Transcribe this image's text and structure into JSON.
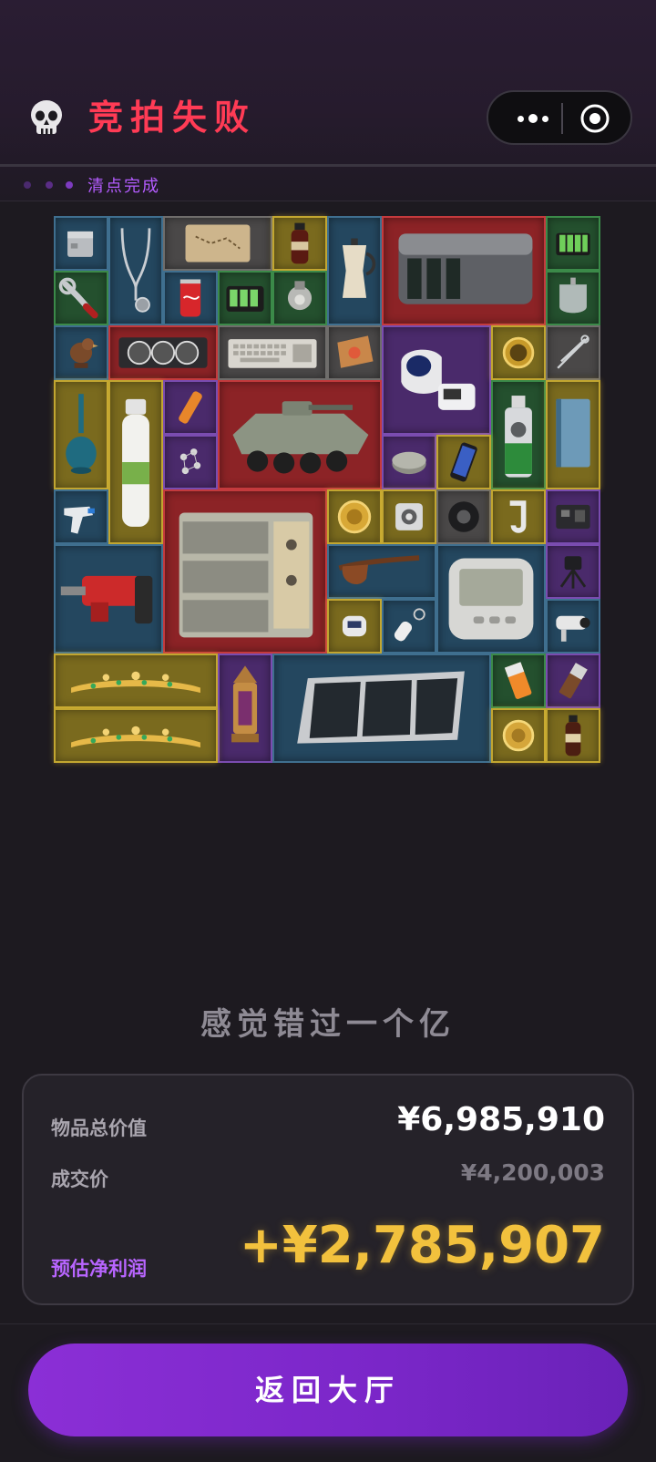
{
  "header": {
    "title": "竞拍失败",
    "skull_icon": "skull-icon",
    "more_icon": "more-dots-icon",
    "target_icon": "target-circle-icon",
    "status": "清点完成"
  },
  "theme": {
    "title_color": "#ff3b55",
    "accent_purple": "#b865ff",
    "profit_color": "#f2c13d",
    "button_gradient": [
      "#8b2fd6",
      "#6a22b8"
    ]
  },
  "inventory": {
    "items": [
      {
        "name": "metal-box",
        "rarity": "blue"
      },
      {
        "name": "stethoscope",
        "rarity": "blue"
      },
      {
        "name": "treasure-map",
        "rarity": "gray"
      },
      {
        "name": "cola-bottle",
        "rarity": "gold"
      },
      {
        "name": "moka-pot",
        "rarity": "blue"
      },
      {
        "name": "server-unit",
        "rarity": "red"
      },
      {
        "name": "battery-pack",
        "rarity": "green"
      },
      {
        "name": "wrench",
        "rarity": "green"
      },
      {
        "name": "soda-can",
        "rarity": "blue"
      },
      {
        "name": "battery-charger",
        "rarity": "green"
      },
      {
        "name": "lamp-bulb",
        "rarity": "green"
      },
      {
        "name": "iv-bag",
        "rarity": "green"
      },
      {
        "name": "bird-statue",
        "rarity": "blue"
      },
      {
        "name": "graphics-card",
        "rarity": "red"
      },
      {
        "name": "keyboard",
        "rarity": "gray"
      },
      {
        "name": "snack-bag",
        "rarity": "gray"
      },
      {
        "name": "blood-pressure-monitor",
        "rarity": "purple"
      },
      {
        "name": "gold-compass",
        "rarity": "gold"
      },
      {
        "name": "scissors",
        "rarity": "gray"
      },
      {
        "name": "glass-vase",
        "rarity": "gold"
      },
      {
        "name": "oxygen-tank",
        "rarity": "gold"
      },
      {
        "name": "flare",
        "rarity": "purple"
      },
      {
        "name": "armored-vehicle",
        "rarity": "red"
      },
      {
        "name": "spray-can",
        "rarity": "green"
      },
      {
        "name": "book",
        "rarity": "gold"
      },
      {
        "name": "jewelry",
        "rarity": "purple"
      },
      {
        "name": "tuna-can",
        "rarity": "purple"
      },
      {
        "name": "smartphone",
        "rarity": "gold"
      },
      {
        "name": "thermometer-gun",
        "rarity": "blue"
      },
      {
        "name": "power-module",
        "rarity": "red"
      },
      {
        "name": "gold-coin",
        "rarity": "gold"
      },
      {
        "name": "companion-cube",
        "rarity": "gold"
      },
      {
        "name": "tape-roll",
        "rarity": "gray"
      },
      {
        "name": "hook-clip",
        "rarity": "gold"
      },
      {
        "name": "circuit-board",
        "rarity": "purple"
      },
      {
        "name": "demolition-hammer",
        "rarity": "blue"
      },
      {
        "name": "tobacco-pipe",
        "rarity": "blue"
      },
      {
        "name": "digital-thermometer",
        "rarity": "blue"
      },
      {
        "name": "tripod-mount",
        "rarity": "purple"
      },
      {
        "name": "oximeter",
        "rarity": "gold"
      },
      {
        "name": "key-tag",
        "rarity": "blue"
      },
      {
        "name": "security-camera",
        "rarity": "blue"
      },
      {
        "name": "gold-tiara-1",
        "rarity": "gold"
      },
      {
        "name": "gold-tiara-2",
        "rarity": "gold"
      },
      {
        "name": "ornate-lantern",
        "rarity": "purple"
      },
      {
        "name": "solar-panel",
        "rarity": "blue"
      },
      {
        "name": "battery-cell",
        "rarity": "green"
      },
      {
        "name": "chocolate-bar",
        "rarity": "purple"
      },
      {
        "name": "gold-medallion",
        "rarity": "gold"
      },
      {
        "name": "coffee-bottle",
        "rarity": "gold"
      }
    ]
  },
  "slogan": "感觉错过一个亿",
  "summary": {
    "total_label": "物品总价值",
    "total_value": "¥6,985,910",
    "deal_label": "成交价",
    "deal_value": "¥4,200,003",
    "profit_label": "预估净利润",
    "profit_value": "+¥2,785,907"
  },
  "back_button": "返回大厅"
}
